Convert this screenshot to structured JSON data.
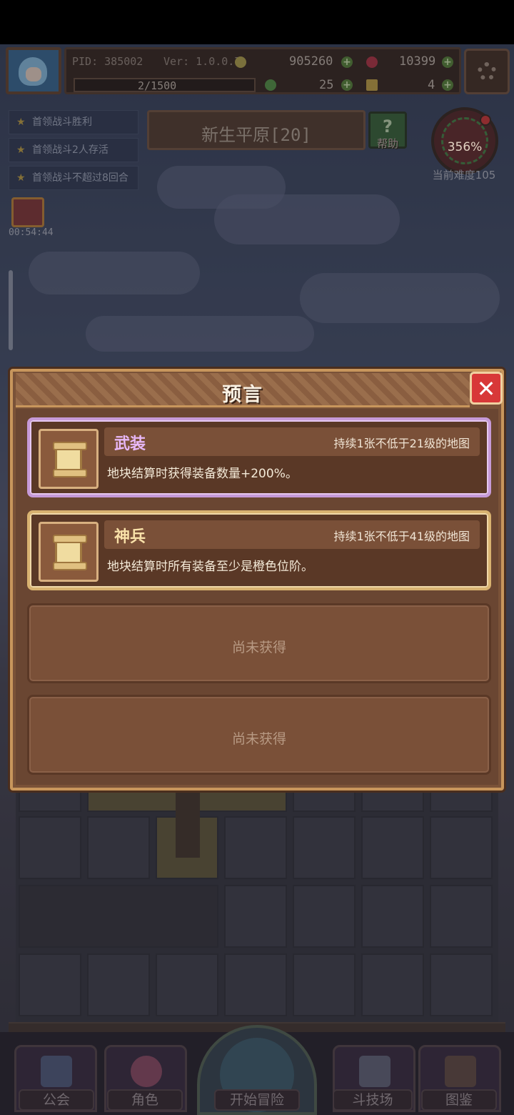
{
  "hud": {
    "pid": "PID: 385002",
    "version": "Ver: 1.0.0.7",
    "gold": "905260",
    "gems": "10399",
    "exp": "2/1500",
    "clover": "25",
    "keys": "4"
  },
  "quests": [
    {
      "label": "首领战斗胜利"
    },
    {
      "label": "首领战斗2人存活"
    },
    {
      "label": "首领战斗不超过8回合"
    }
  ],
  "stage": {
    "name": "新生平原[20]"
  },
  "help": {
    "label": "帮助"
  },
  "difficulty": {
    "percent": "356%",
    "label": "当前难度105"
  },
  "gift": {
    "timer": "00:54:44"
  },
  "modal": {
    "title": "预言",
    "cards": [
      {
        "name": "武装",
        "condition": "持续1张不低于21级的地图",
        "description": "地块结算时获得装备数量+200%。",
        "name_color": "#e8b8f8"
      },
      {
        "name": "神兵",
        "condition": "持续1张不低于41级的地图",
        "description": "地块结算时所有装备至少是橙色位阶。",
        "name_color": "#f8e0a8"
      }
    ],
    "empty_label_1": "尚未获得",
    "empty_label_2": "尚未获得"
  },
  "nav": {
    "guild": "公会",
    "character": "角色",
    "start": "开始冒险",
    "arena": "斗技场",
    "codex": "图鉴"
  }
}
